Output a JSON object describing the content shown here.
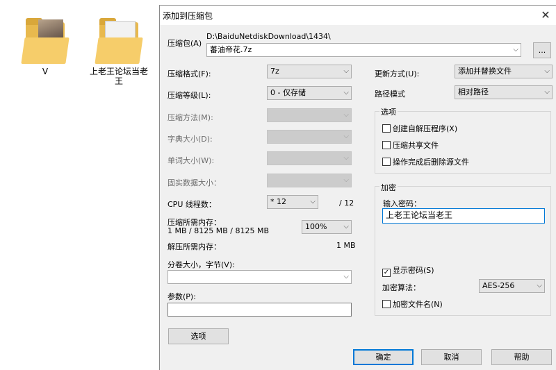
{
  "desktop": {
    "folders": [
      {
        "label": "V"
      },
      {
        "label": "上老王论坛当老王"
      }
    ]
  },
  "dialog": {
    "title": "添加到压缩包",
    "archive_label": "压缩包(A)",
    "archive_path": "D:\\BaiduNetdiskDownload\\1434\\",
    "archive_name": "蕃油帝花.7z",
    "browse_button": "...",
    "format_label": "压缩格式(F):",
    "format_value": "7z",
    "level_label": "压缩等级(L):",
    "level_value": "0 - 仅存储",
    "method_label": "压缩方法(M):",
    "dict_label": "字典大小(D):",
    "word_label": "单词大小(W):",
    "solid_label": "固实数据大小：",
    "cpu_label": "CPU 线程数：",
    "cpu_value": "* 12",
    "cpu_max": "/ 12",
    "mem_compress_label": "压缩所需内存：",
    "mem_compress_value": "1 MB / 8125 MB / 8125 MB",
    "mem_percent": "100%",
    "mem_decompress_label": "解压所需内存：",
    "mem_decompress_value": "1 MB",
    "split_label": "分卷大小，字节(V):",
    "split_value": "",
    "params_label": "参数(P):",
    "params_value": "",
    "options_button": "选项",
    "update_label": "更新方式(U):",
    "update_value": "添加并替换文件",
    "path_label": "路径模式",
    "path_value": "相对路径",
    "options_group": "选项",
    "opt_sfx": "创建自解压程序(X)",
    "opt_shared": "压缩共享文件",
    "opt_delete": "操作完成后删除源文件",
    "encrypt_group": "加密",
    "password_label": "输入密码：",
    "password_value": "上老王论坛当老王",
    "show_password": "显示密码(S)",
    "encrypt_method_label": "加密算法：",
    "encrypt_method_value": "AES-256",
    "encrypt_names": "加密文件名(N)",
    "ok_button": "确定",
    "cancel_button": "取消",
    "help_button": "帮助"
  },
  "icons": {
    "close": "close-icon",
    "dropdown": "chevron-down-icon",
    "check": "check-icon"
  }
}
